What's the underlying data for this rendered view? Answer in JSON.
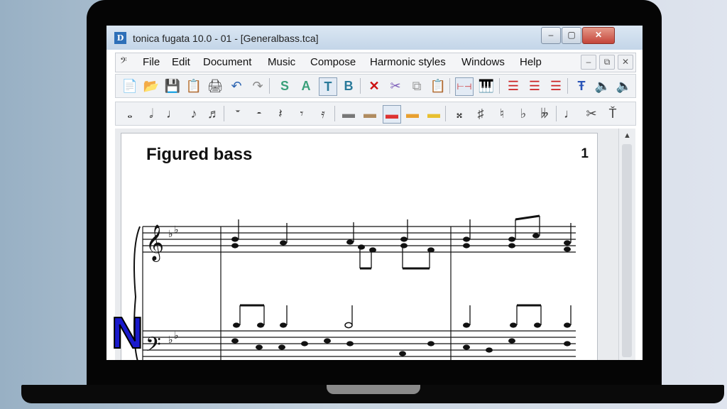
{
  "window": {
    "title": "tonica fugata 10.0 - 01 - [Generalbass.tca]",
    "app_icon_text": "D",
    "minimize": "–",
    "maximize": "▢",
    "close": "✕"
  },
  "menubar": {
    "icon": "𝄢",
    "items": [
      "File",
      "Edit",
      "Document",
      "Music",
      "Compose",
      "Harmonic styles",
      "Windows",
      "Help"
    ],
    "mdi_minimize": "–",
    "mdi_restore": "⧉",
    "mdi_close": "✕"
  },
  "toolbar1": [
    "📄",
    "📂",
    "💾",
    "📋",
    "🖨",
    "↶",
    "↷",
    "S",
    "A",
    "T",
    "B",
    "✕",
    "✂",
    "⧉",
    "📋",
    "⊢⊣",
    "🎹",
    "☰",
    "☰",
    "☰",
    "Ŧ",
    "🔈",
    "🔈"
  ],
  "toolbar2": [
    "𝅝",
    "𝅗𝅥",
    "♩",
    "♪",
    "♬",
    "𝄻",
    "𝄼",
    "𝄽",
    "𝄾",
    "𝄿",
    "▬",
    "▬",
    "▬",
    "▬",
    "▬",
    "𝄪",
    "♯",
    "♮",
    "♭",
    "𝄫",
    "♩",
    "✂",
    "Ť"
  ],
  "document": {
    "title": "Figured bass",
    "page_number": "1"
  },
  "logo": {
    "letter": "N",
    "color": "#1a1acc"
  }
}
